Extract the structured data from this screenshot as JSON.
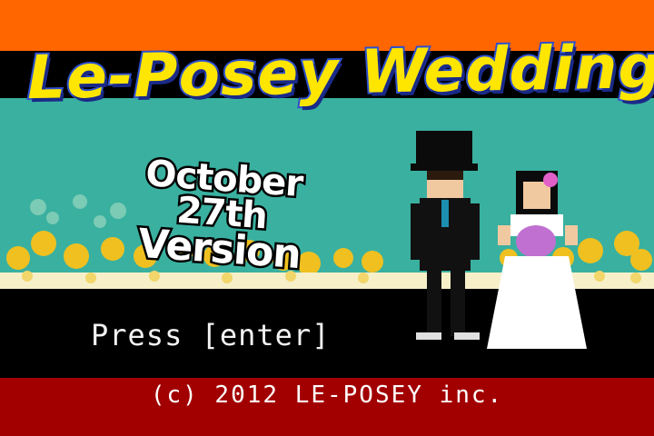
{
  "title": "Le-Posey Wedding",
  "subtitle": {
    "line1": "October 27th",
    "line2": "Version"
  },
  "prompt": "Press [enter]",
  "copyright": "(c) 2012 LE-POSEY inc.",
  "sprites": {
    "groom": "groom-sprite",
    "bride": "bride-sprite",
    "chicks": "chick-flock"
  },
  "colors": {
    "top_band": "#ff6600",
    "sky": "#3ab0a0",
    "bottom_band": "#a20000",
    "title_fill": "#ffe600",
    "title_outline": "#2d4fd0"
  }
}
